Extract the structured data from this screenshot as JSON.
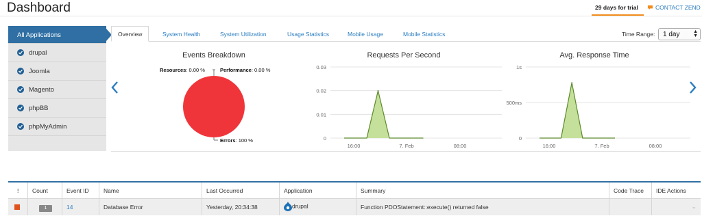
{
  "header": {
    "title": "Dashboard",
    "trial": "29 days for trial",
    "contact": "CONTACT ZEND"
  },
  "sidebar": {
    "items": [
      {
        "label": "All Applications",
        "active": true
      },
      {
        "label": "drupal"
      },
      {
        "label": "Joomla"
      },
      {
        "label": "Magento"
      },
      {
        "label": "phpBB"
      },
      {
        "label": "phpMyAdmin"
      }
    ]
  },
  "tabs": [
    "Overview",
    "System Health",
    "System Utilization",
    "Usage Statistics",
    "Mobile Usage",
    "Mobile Statistics"
  ],
  "time_range": {
    "label": "Time Range:",
    "value": "1 day"
  },
  "chart_data": [
    {
      "type": "pie",
      "title": "Events Breakdown",
      "slices": [
        {
          "label": "Resources",
          "value": 0,
          "display": "0.00 %"
        },
        {
          "label": "Performance",
          "value": 0,
          "display": "0.00 %"
        },
        {
          "label": "Errors",
          "value": 100,
          "display": "100 %"
        }
      ],
      "color": "#f0353a"
    },
    {
      "type": "area",
      "title": "Requests Per Second",
      "x_ticks": [
        "16:00",
        "7. Feb",
        "08:00"
      ],
      "y_ticks": [
        "0",
        "0.01",
        "0.02",
        "0.03"
      ],
      "ylim": [
        0,
        0.03
      ],
      "series": [
        {
          "values": [
            0,
            0,
            0,
            0.02,
            0,
            0,
            0,
            0
          ]
        }
      ],
      "fill": "#c5e09a",
      "stroke": "#5c8a2c"
    },
    {
      "type": "area",
      "title": "Avg. Response Time",
      "x_ticks": [
        "16:00",
        "7. Feb",
        "08:00"
      ],
      "y_ticks": [
        "0",
        "500ms",
        "1s"
      ],
      "ylim": [
        0,
        1000
      ],
      "series": [
        {
          "values": [
            0,
            0,
            0,
            780,
            0,
            0,
            0,
            0
          ]
        }
      ],
      "fill": "#c5e09a",
      "stroke": "#5c8a2c"
    }
  ],
  "table": {
    "headers": [
      "!",
      "Count",
      "Event ID",
      "Name",
      "Last Occurred",
      "Application",
      "Summary",
      "Code Trace",
      "IDE Actions"
    ],
    "rows": [
      {
        "count": "1",
        "event_id": "14",
        "name": "Database Error",
        "last_occurred": "Yesterday, 20:34:38",
        "application": "drupal",
        "summary": "Function PDOStatement::execute() returned false"
      }
    ]
  },
  "colors": {
    "accent": "#2f6fa3",
    "link": "#2b7dc0",
    "severity": "#e0521f",
    "trial_underline": "#f28c1c"
  }
}
